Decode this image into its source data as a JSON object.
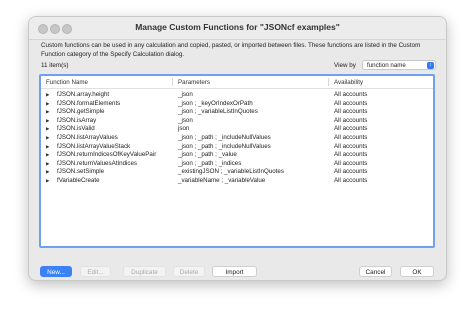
{
  "window": {
    "title": "Manage Custom Functions for \"JSONcf examples\""
  },
  "description": "Custom functions can be used in any calculation and copied, pasted, or imported between files. These functions are listed in the Custom Function category of the Specify Calculation dialog.",
  "item_count": "11 item(s)",
  "view_by": {
    "label": "View by",
    "value": "function name"
  },
  "columns": [
    "Function Name",
    "Parameters",
    "Availability"
  ],
  "rows": [
    {
      "name": "fJSON.array.height",
      "params": "_json",
      "availability": "All accounts"
    },
    {
      "name": "fJSON.formatElements",
      "params": "_json ; _keyOrIndexOrPath",
      "availability": "All accounts"
    },
    {
      "name": "fJSON.getSimple",
      "params": "_json ; _variableListInQuotes",
      "availability": "All accounts"
    },
    {
      "name": "fJSON.isArray",
      "params": "_json",
      "availability": "All accounts"
    },
    {
      "name": "fJSON.isValid",
      "params": "json",
      "availability": "All accounts"
    },
    {
      "name": "fJSON.listArrayValues",
      "params": "_json ; _path ; _includeNullValues",
      "availability": "All accounts"
    },
    {
      "name": "fJSON.listArrayValueStack",
      "params": "_json ; _path ; _includeNullValues",
      "availability": "All accounts"
    },
    {
      "name": "fJSON.returnIndicesOfKeyValuePair",
      "params": "_json ; _path ; _value",
      "availability": "All accounts"
    },
    {
      "name": "fJSON.returnValuesAtIndices",
      "params": "_json ; _path ; _indices",
      "availability": "All accounts"
    },
    {
      "name": "fJSON.setSimple",
      "params": "_existingJSON ; _variableListInQuotes",
      "availability": "All accounts"
    },
    {
      "name": "fVariableCreate",
      "params": "_variableName ; _variableValue",
      "availability": "All accounts"
    }
  ],
  "buttons": {
    "new": "New...",
    "edit": "Edit...",
    "duplicate": "Duplicate",
    "delete": "Delete",
    "import": "Import",
    "cancel": "Cancel",
    "ok": "OK"
  },
  "colors": {
    "accent": "#3b82f6",
    "focus_ring": "#6ea2f0"
  }
}
